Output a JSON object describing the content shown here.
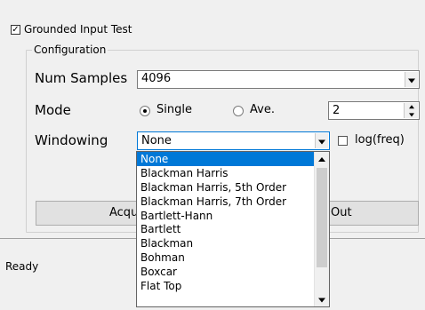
{
  "grounded_test": {
    "label": "Grounded Input Test",
    "checked": true
  },
  "config": {
    "legend": "Configuration",
    "num_samples": {
      "label": "Num Samples",
      "value": "4096"
    },
    "mode": {
      "label": "Mode",
      "single_label": "Single",
      "ave_label": "Ave.",
      "selected": "Single",
      "average_count": "2"
    },
    "windowing": {
      "label": "Windowing",
      "value": "None",
      "log_freq_label": "log(freq)",
      "log_freq_checked": false,
      "options": [
        "None",
        "Blackman Harris",
        "Blackman Harris, 5th Order",
        "Blackman Harris, 7th Order",
        "Bartlett-Hann",
        "Bartlett",
        "Blackman",
        "Bohman",
        "Boxcar",
        "Flat Top"
      ],
      "selected_index": 0
    }
  },
  "buttons": {
    "acquire_visible": "Acqu",
    "right_visible": "Out"
  },
  "status": {
    "text": "Ready"
  },
  "icons": {
    "check": "✓"
  }
}
